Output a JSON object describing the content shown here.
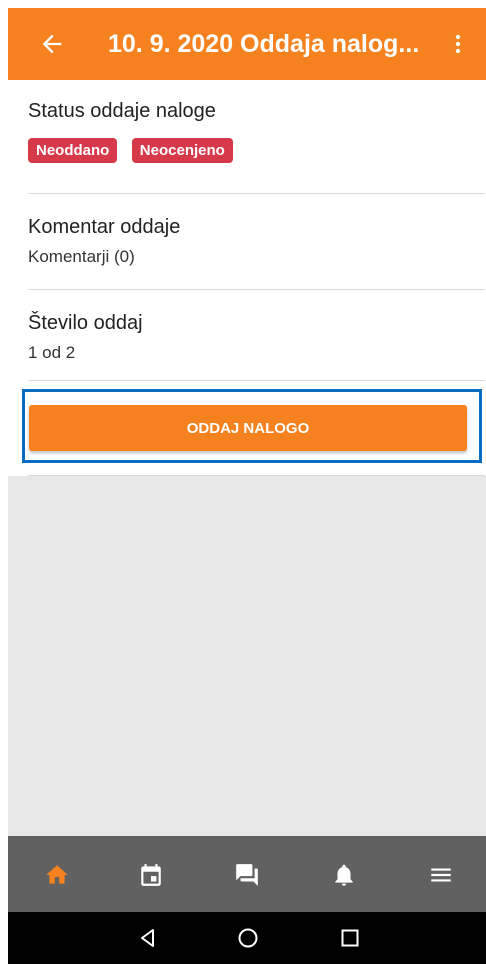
{
  "header": {
    "title": "10. 9. 2020 Oddaja nalog..."
  },
  "status": {
    "label": "Status oddaje naloge",
    "badges": [
      "Neoddano",
      "Neocenjeno"
    ],
    "badge_color": "#d63a4a"
  },
  "comment": {
    "label": "Komentar oddaje",
    "value": "Komentarji (0)"
  },
  "count": {
    "label": "Število oddaj",
    "value": "1 od 2"
  },
  "submit_button": {
    "label": "ODDAJ NALOGO",
    "color": "#f5821f"
  },
  "bottom_nav": {
    "items": [
      "home-icon",
      "calendar-icon",
      "chat-icon",
      "bell-icon",
      "menu-icon"
    ],
    "active": "home-icon",
    "active_color": "#f5821f"
  },
  "system_nav": [
    "back-triangle-icon",
    "home-circle-icon",
    "recents-square-icon"
  ],
  "theme": {
    "accent": "#f5821f",
    "highlight_border": "#0a6cc0"
  }
}
